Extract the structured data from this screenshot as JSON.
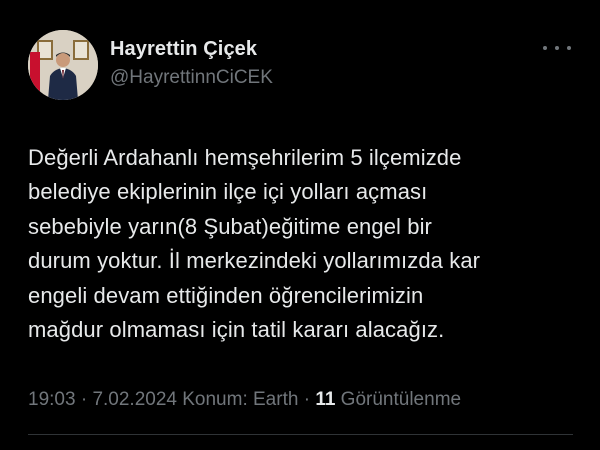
{
  "author": {
    "name": "Hayrettin Çiçek",
    "handle": "@HayrettinnCiCEK"
  },
  "tweet": {
    "text": "Değerli Ardahanlı hemşehrilerim 5 ilçemizde\nbelediye ekiplerinin ilçe içi yolları açması\nsebebiyle yarın(8 Şubat)eğitime engel bir\ndurum yoktur. İl merkezindeki yollarımızda kar\nengeli devam ettiğinden öğrencilerimizin\nmağdur olmaması için tatil kararı alacağız."
  },
  "meta": {
    "time": "19:03",
    "sep1": " · ",
    "date": "7.02.2024",
    "location": " Konum: Earth",
    "sep2": " · ",
    "views_count": "11",
    "views_label": " Görüntülenme"
  },
  "icons": {
    "more": "more-horizontal-icon"
  },
  "colors": {
    "background": "#000000",
    "primary_text": "#e7e9ea",
    "secondary_text": "#71767b",
    "divider": "#2f3336"
  }
}
